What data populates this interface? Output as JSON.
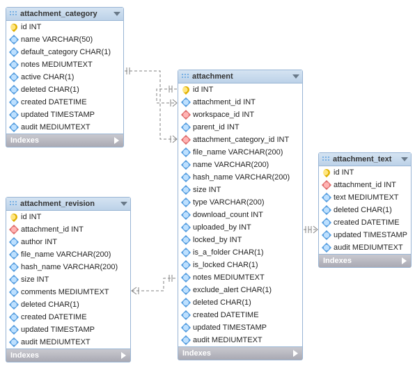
{
  "tables": {
    "attachment_category": {
      "title": "attachment_category",
      "columns": [
        {
          "kind": "pk",
          "label": "id INT"
        },
        {
          "kind": "fld",
          "label": "name VARCHAR(50)"
        },
        {
          "kind": "fld",
          "label": "default_category CHAR(1)"
        },
        {
          "kind": "fld",
          "label": "notes MEDIUMTEXT"
        },
        {
          "kind": "fld",
          "label": "active CHAR(1)"
        },
        {
          "kind": "fld",
          "label": "deleted CHAR(1)"
        },
        {
          "kind": "fld",
          "label": "created DATETIME"
        },
        {
          "kind": "fld",
          "label": "updated TIMESTAMP"
        },
        {
          "kind": "fld",
          "label": "audit MEDIUMTEXT"
        }
      ]
    },
    "attachment_revision": {
      "title": "attachment_revision",
      "columns": [
        {
          "kind": "pk",
          "label": "id INT"
        },
        {
          "kind": "fk",
          "label": "attachment_id INT"
        },
        {
          "kind": "fld",
          "label": "author INT"
        },
        {
          "kind": "fld",
          "label": "file_name VARCHAR(200)"
        },
        {
          "kind": "fld",
          "label": "hash_name VARCHAR(200)"
        },
        {
          "kind": "fld",
          "label": "size INT"
        },
        {
          "kind": "fld",
          "label": "comments MEDIUMTEXT"
        },
        {
          "kind": "fld",
          "label": "deleted CHAR(1)"
        },
        {
          "kind": "fld",
          "label": "created DATETIME"
        },
        {
          "kind": "fld",
          "label": "updated TIMESTAMP"
        },
        {
          "kind": "fld",
          "label": "audit MEDIUMTEXT"
        }
      ]
    },
    "attachment": {
      "title": "attachment",
      "columns": [
        {
          "kind": "pk",
          "label": "id INT"
        },
        {
          "kind": "fld",
          "label": "attachment_id INT"
        },
        {
          "kind": "fk",
          "label": "workspace_id INT"
        },
        {
          "kind": "fld",
          "label": "parent_id INT"
        },
        {
          "kind": "fk",
          "label": "attachment_category_id INT"
        },
        {
          "kind": "fld",
          "label": "file_name VARCHAR(200)"
        },
        {
          "kind": "fld",
          "label": "name VARCHAR(200)"
        },
        {
          "kind": "fld",
          "label": "hash_name VARCHAR(200)"
        },
        {
          "kind": "fld",
          "label": "size INT"
        },
        {
          "kind": "fld",
          "label": "type VARCHAR(200)"
        },
        {
          "kind": "fld",
          "label": "download_count INT"
        },
        {
          "kind": "fld",
          "label": "uploaded_by INT"
        },
        {
          "kind": "fld",
          "label": "locked_by INT"
        },
        {
          "kind": "fld",
          "label": "is_a_folder CHAR(1)"
        },
        {
          "kind": "fld",
          "label": "is_locked CHAR(1)"
        },
        {
          "kind": "fld",
          "label": "notes MEDIUMTEXT"
        },
        {
          "kind": "fld",
          "label": "exclude_alert CHAR(1)"
        },
        {
          "kind": "fld",
          "label": "deleted CHAR(1)"
        },
        {
          "kind": "fld",
          "label": "created DATETIME"
        },
        {
          "kind": "fld",
          "label": "updated TIMESTAMP"
        },
        {
          "kind": "fld",
          "label": "audit MEDIUMTEXT"
        }
      ]
    },
    "attachment_text": {
      "title": "attachment_text",
      "columns": [
        {
          "kind": "pk",
          "label": "id INT"
        },
        {
          "kind": "fk",
          "label": "attachment_id INT"
        },
        {
          "kind": "fld",
          "label": "text MEDIUMTEXT"
        },
        {
          "kind": "fld",
          "label": "deleted CHAR(1)"
        },
        {
          "kind": "fld",
          "label": "created DATETIME"
        },
        {
          "kind": "fld",
          "label": "updated TIMESTAMP"
        },
        {
          "kind": "fld",
          "label": "audit MEDIUMTEXT"
        }
      ]
    }
  },
  "indexes_label": "Indexes",
  "chart_data": {
    "type": "erd",
    "entities": [
      "attachment_category",
      "attachment_revision",
      "attachment",
      "attachment_text"
    ],
    "relationships": [
      {
        "from": "attachment.attachment_category_id",
        "to": "attachment_category.id",
        "cardinality": "many-to-one"
      },
      {
        "from": "attachment.attachment_id",
        "to": "attachment.id",
        "self": true,
        "cardinality": "many-to-one"
      },
      {
        "from": "attachment_revision.attachment_id",
        "to": "attachment.id",
        "cardinality": "many-to-one"
      },
      {
        "from": "attachment_text.attachment_id",
        "to": "attachment.id",
        "cardinality": "many-to-one"
      }
    ]
  }
}
